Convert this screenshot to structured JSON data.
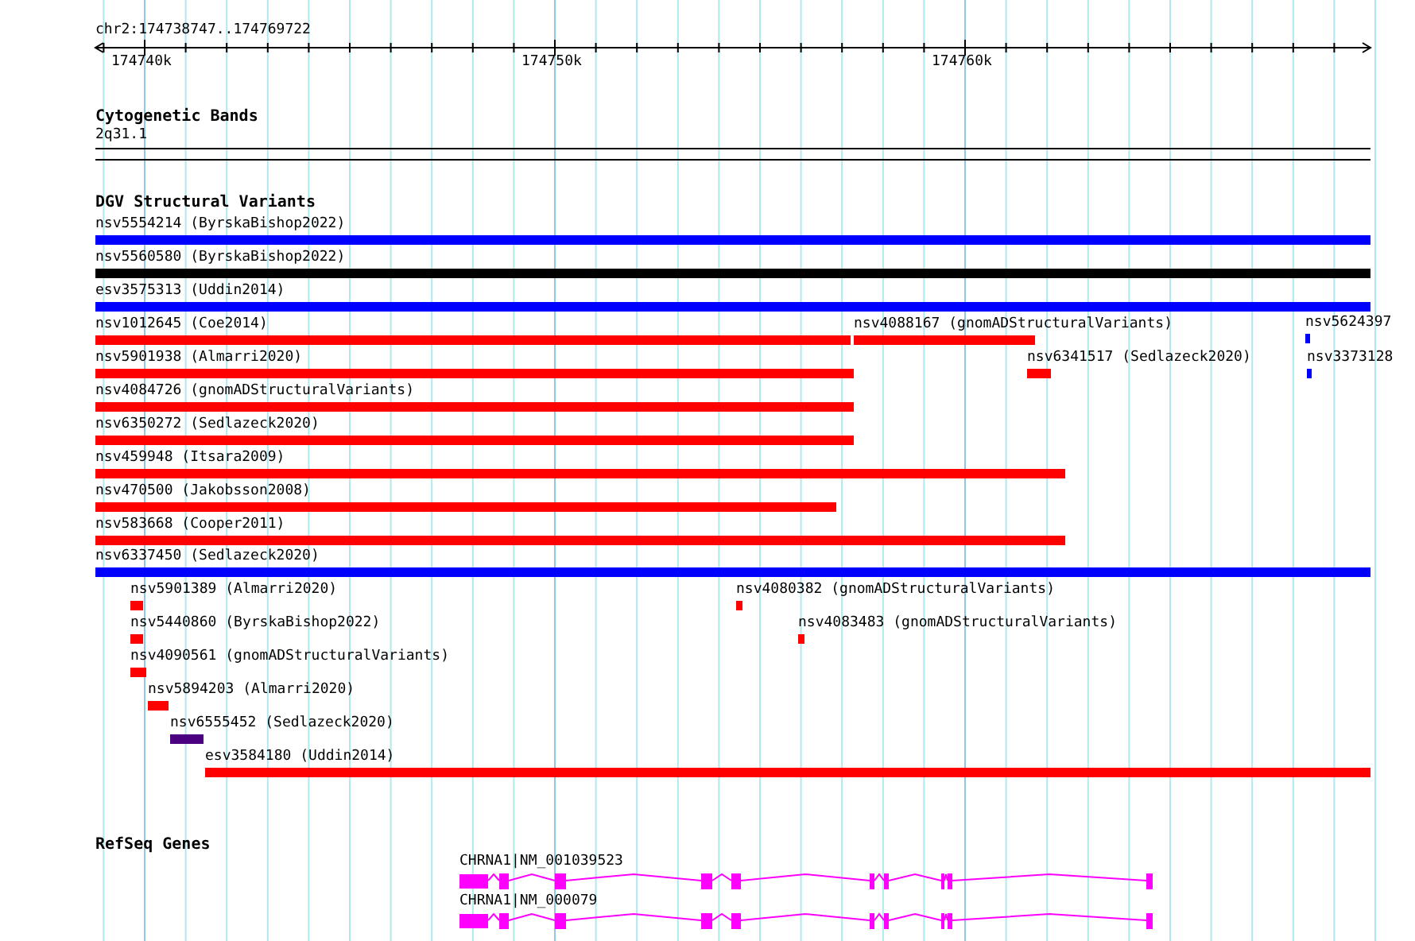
{
  "ruler": {
    "location": "chr2:174738747..174769722",
    "ticks": [
      "174740k",
      "174750k",
      "174760k"
    ]
  },
  "tracks": [
    {
      "kind": "bands",
      "title": "Cytogenetic Bands",
      "bands": [
        "2q31.1"
      ]
    },
    {
      "kind": "variants",
      "title": "DGV Structural Variants",
      "features": [
        {
          "label": "nsv5554214 (ByrskaBishop2022)",
          "color": "#0000ff"
        },
        {
          "label": "nsv5560580 (ByrskaBishop2022)",
          "color": "#000000"
        },
        {
          "label": "esv3575313 (Uddin2014)",
          "color": "#0000ff"
        },
        {
          "label": "nsv1012645 (Coe2014)",
          "color": "#ff0000"
        },
        {
          "label": "nsv4088167 (gnomADStructuralVariants)",
          "color": "#ff0000"
        },
        {
          "label": "nsv5624397",
          "color": "#0000ff"
        },
        {
          "label": "nsv5901938 (Almarri2020)",
          "color": "#ff0000"
        },
        {
          "label": "nsv6341517 (Sedlazeck2020)",
          "color": "#ff0000"
        },
        {
          "label": "nsv3373128",
          "color": "#0000ff"
        },
        {
          "label": "nsv4084726 (gnomADStructuralVariants)",
          "color": "#ff0000"
        },
        {
          "label": "nsv6350272 (Sedlazeck2020)",
          "color": "#ff0000"
        },
        {
          "label": "nsv459948 (Itsara2009)",
          "color": "#ff0000"
        },
        {
          "label": "nsv470500 (Jakobsson2008)",
          "color": "#ff0000"
        },
        {
          "label": "nsv583668 (Cooper2011)",
          "color": "#ff0000"
        },
        {
          "label": "nsv6337450 (Sedlazeck2020)",
          "color": "#0000ff"
        },
        {
          "label": "nsv5901389 (Almarri2020)",
          "color": "#ff0000"
        },
        {
          "label": "nsv4080382 (gnomADStructuralVariants)",
          "color": "#ff0000"
        },
        {
          "label": "nsv5440860 (ByrskaBishop2022)",
          "color": "#ff0000"
        },
        {
          "label": "nsv4083483 (gnomADStructuralVariants)",
          "color": "#ff0000"
        },
        {
          "label": "nsv4090561 (gnomADStructuralVariants)",
          "color": "#ff0000"
        },
        {
          "label": "nsv5894203 (Almarri2020)",
          "color": "#ff0000"
        },
        {
          "label": "nsv6555452 (Sedlazeck2020)",
          "color": "#4b0082"
        },
        {
          "label": "esv3584180 (Uddin2014)",
          "color": "#ff0000"
        }
      ]
    },
    {
      "kind": "genes",
      "title": "RefSeq Genes",
      "transcripts": [
        {
          "label": "CHRNA1|NM_001039523"
        },
        {
          "label": "CHRNA1|NM_000079"
        }
      ]
    }
  ]
}
